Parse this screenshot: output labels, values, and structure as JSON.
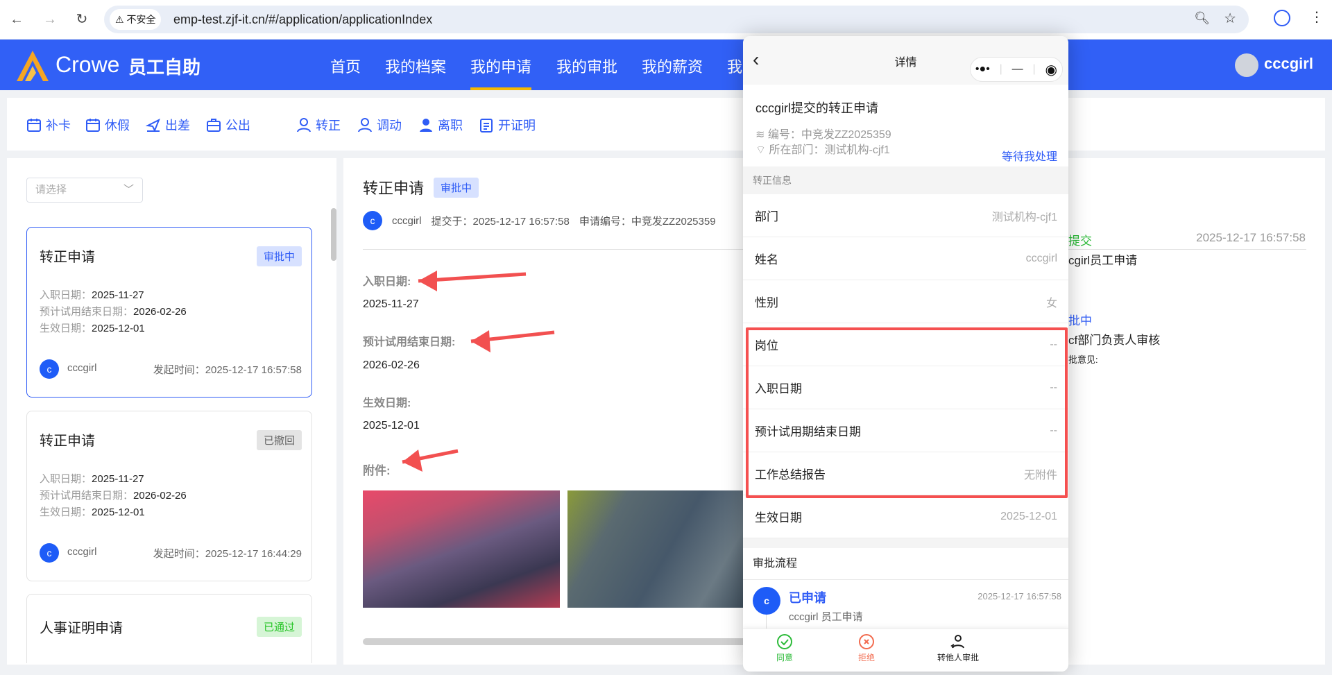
{
  "browser": {
    "insecure": "不安全",
    "url": "emp-test.zjf-it.cn/#/application/applicationIndex"
  },
  "header": {
    "brand": "Crowe",
    "brand_cn": "员工自助",
    "nav": [
      "首页",
      "我的档案",
      "我的申请",
      "我的审批",
      "我的薪资",
      "我"
    ],
    "active": "我的申请",
    "user": "cccgirl"
  },
  "quick": [
    "补卡",
    "休假",
    "出差",
    "公出",
    "转正",
    "调动",
    "离职",
    "开证明"
  ],
  "list": {
    "select_placeholder": "请选择",
    "chevron": "﹀",
    "cards": [
      {
        "title": "转正申请",
        "status": "审批中",
        "fields": [
          [
            "入职日期：",
            "2025-11-27"
          ],
          [
            "预计试用结束日期：",
            "2026-02-26"
          ],
          [
            "生效日期：",
            "2025-12-01"
          ]
        ],
        "avatar": "c",
        "user": "cccgirl",
        "time_label": "发起时间：",
        "time": "2025-12-17 16:57:58"
      },
      {
        "title": "转正申请",
        "status": "已撤回",
        "fields": [
          [
            "入职日期：",
            "2025-11-27"
          ],
          [
            "预计试用结束日期：",
            "2026-02-26"
          ],
          [
            "生效日期：",
            "2025-12-01"
          ]
        ],
        "avatar": "c",
        "user": "cccgirl",
        "time_label": "发起时间：",
        "time": "2025-12-17 16:44:29"
      },
      {
        "title": "人事证明申请",
        "status": "已通过"
      }
    ]
  },
  "detail": {
    "title": "转正申请",
    "status": "审批中",
    "avatar": "c",
    "user": "cccgirl",
    "submitted": "提交于：2025-12-17 16:57:58",
    "number": "申请编号：中竞发ZZ2025359",
    "fields": [
      {
        "label": "入职日期:",
        "value": "2025-11-27"
      },
      {
        "label": "预计试用结束日期:",
        "value": "2026-02-26"
      },
      {
        "label": "生效日期:",
        "value": "2025-12-01"
      }
    ],
    "attachments_label": "附件:"
  },
  "timeline": [
    {
      "status": "提交",
      "time": "2025-12-17 16:57:58",
      "desc": "cgirl员工申请"
    },
    {
      "status": "批中",
      "desc": "cf部门负责人审核",
      "opinion": "批意见:"
    }
  ],
  "popup": {
    "back": "‹",
    "title": "详情",
    "capsule": {
      "more": "•●•",
      "min": "—",
      "close": "◉"
    },
    "subject": "cccgirl提交的转正申请",
    "number": "编号：中竞发ZZ2025359",
    "dept": "所在部门：测试机构-cjf1",
    "pending": "等待我处理",
    "section": "转正信息",
    "rows": [
      {
        "k": "部门",
        "v": "测试机构-cjf1"
      },
      {
        "k": "姓名",
        "v": "cccgirl"
      },
      {
        "k": "性别",
        "v": "女"
      },
      {
        "k": "岗位",
        "v": "--"
      },
      {
        "k": "入职日期",
        "v": "--"
      },
      {
        "k": "预计试用期结束日期",
        "v": "--"
      },
      {
        "k": "工作总结报告",
        "v": "无附件"
      },
      {
        "k": "生效日期",
        "v": "2025-12-01"
      }
    ],
    "flow_title": "审批流程",
    "flow": {
      "avatar": "c",
      "status": "已申请",
      "time": "2025-12-17 16:57:58",
      "desc": "cccgirl 员工申请"
    },
    "actions": {
      "agree": "同意",
      "reject": "拒绝",
      "transfer": "转他人审批"
    },
    "colors": {
      "agree": "#2dbb3a",
      "reject": "#f26b4f",
      "accent": "#2f5cf6"
    }
  }
}
